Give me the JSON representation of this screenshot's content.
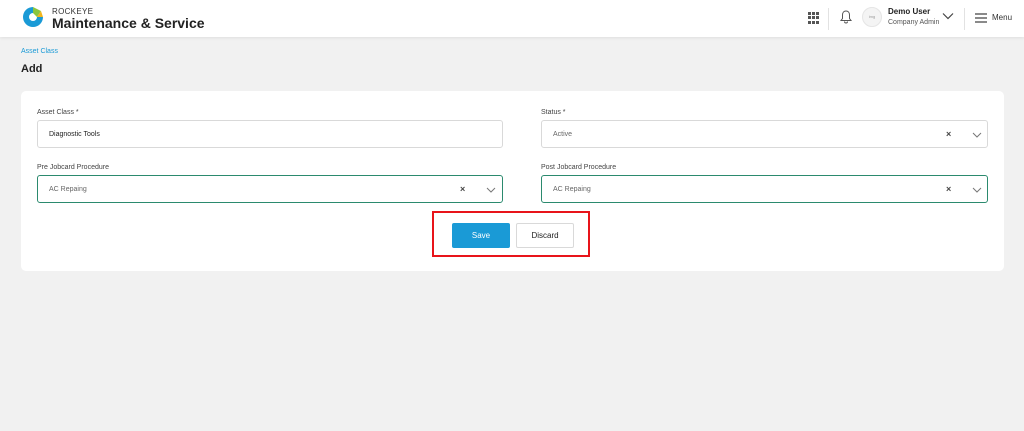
{
  "header": {
    "brand_top": "ROCKEYE",
    "brand_main": "Maintenance & Service",
    "user_name": "Demo User",
    "user_role": "Company Admin",
    "menu_label": "Menu",
    "avatar_text": "img"
  },
  "breadcrumb": "Asset Class",
  "page_title": "Add",
  "form": {
    "asset_class": {
      "label": "Asset Class *",
      "value": "Diagnostic Tools"
    },
    "status": {
      "label": "Status *",
      "value": "Active"
    },
    "pre_jobcard": {
      "label": "Pre Jobcard Procedure",
      "value": "AC Repaing"
    },
    "post_jobcard": {
      "label": "Post Jobcard Procedure",
      "value": "AC Repaing"
    },
    "clear_symbol": "×"
  },
  "actions": {
    "save_label": "Save",
    "discard_label": "Discard"
  },
  "colors": {
    "primary": "#1a9ad6",
    "highlight": "#e8141a",
    "focus_border": "#2b8a6e"
  }
}
